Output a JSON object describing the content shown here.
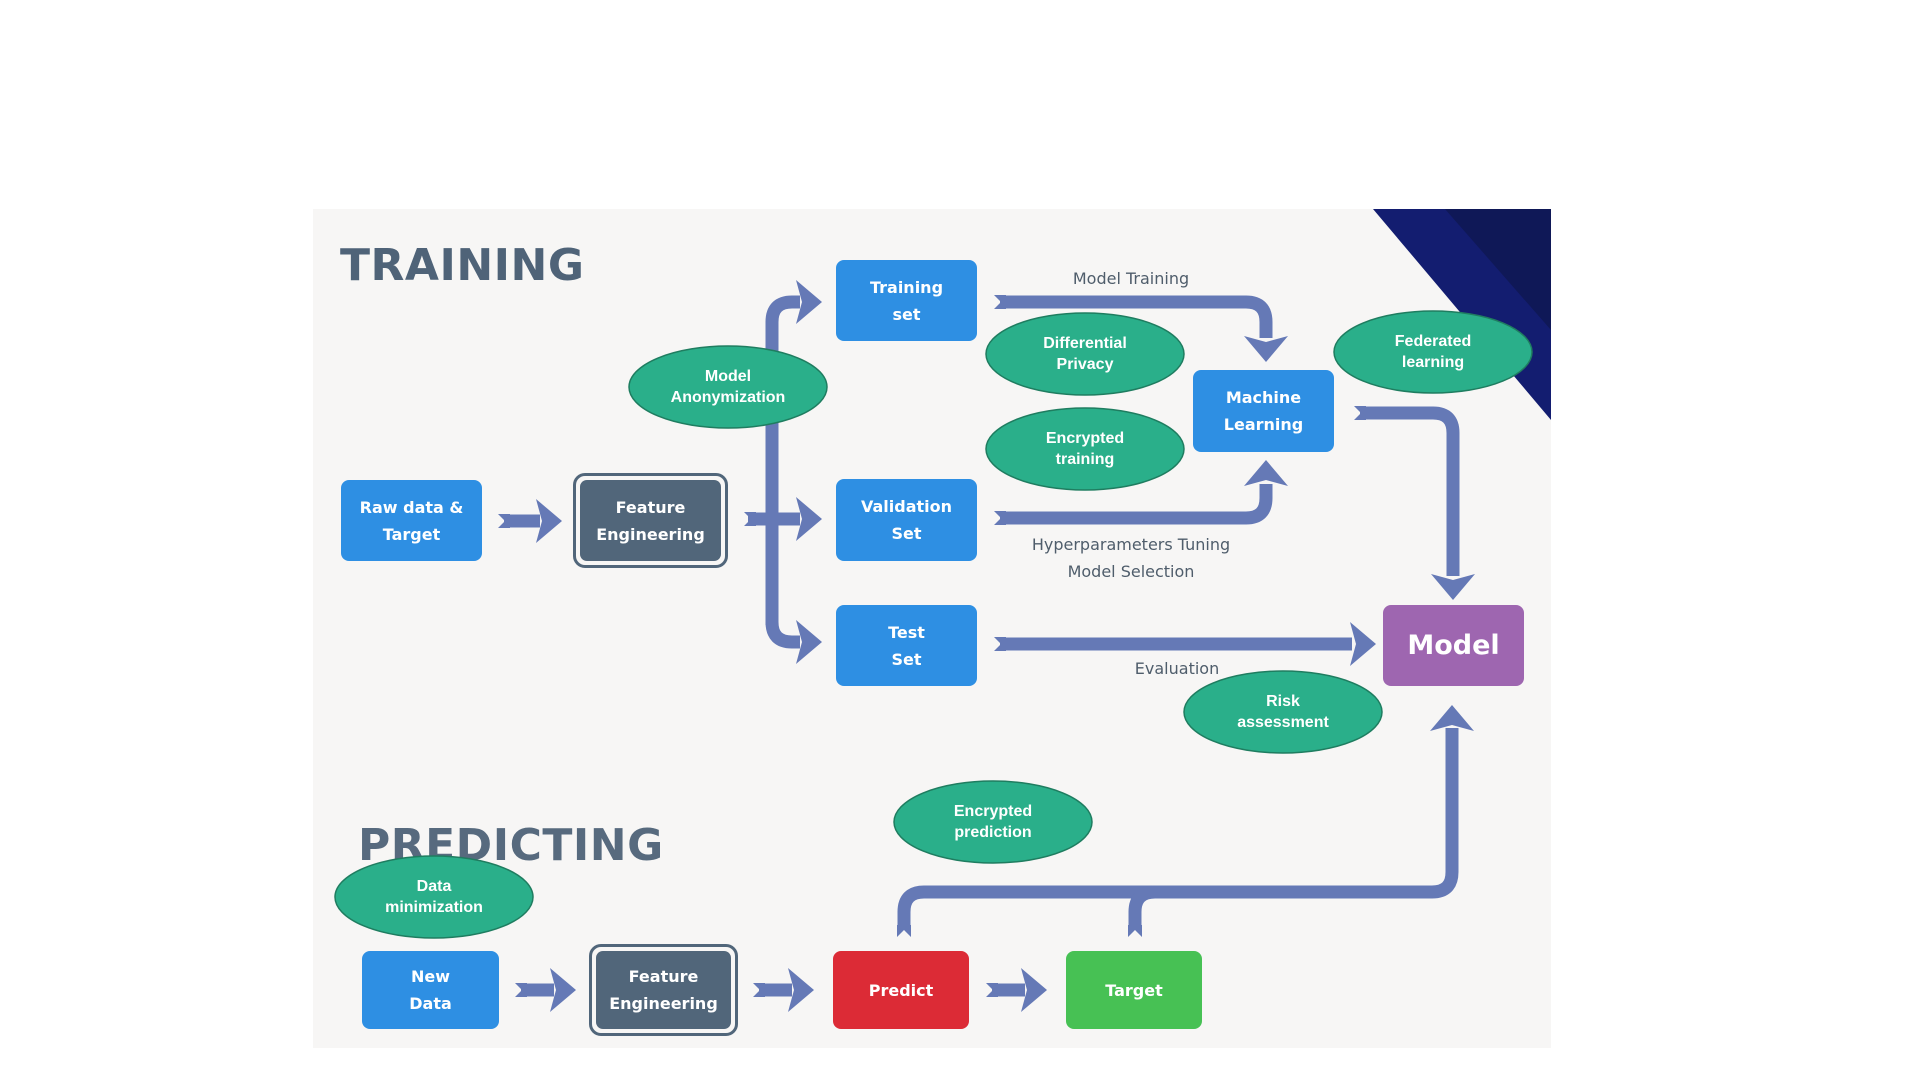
{
  "titles": {
    "training": "TRAINING",
    "predicting": "PREDICTING"
  },
  "training": {
    "raw_data": [
      "Raw data &",
      "Target"
    ],
    "feature_engineering": [
      "Feature",
      "Engineering"
    ],
    "training_set": [
      "Training",
      "set"
    ],
    "validation_set": [
      "Validation",
      "Set"
    ],
    "test_set": [
      "Test",
      "Set"
    ],
    "machine_learning": [
      "Machine",
      "Learning"
    ],
    "model": "Model"
  },
  "predicting": {
    "new_data": [
      "New",
      "Data"
    ],
    "feature_engineering": [
      "Feature",
      "Engineering"
    ],
    "predict": "Predict",
    "target": "Target"
  },
  "edge_labels": {
    "model_training": "Model Training",
    "hyperparameters_tuning": "Hyperparameters Tuning",
    "model_selection": "Model Selection",
    "evaluation": "Evaluation"
  },
  "privacy_techniques": {
    "model_anonymization": [
      "Model",
      "Anonymization"
    ],
    "differential_privacy": [
      "Differential",
      "Privacy"
    ],
    "encrypted_training": [
      "Encrypted",
      "training"
    ],
    "federated_learning": [
      "Federated",
      "learning"
    ],
    "risk_assessment": [
      "Risk",
      "assessment"
    ],
    "encrypted_prediction": [
      "Encrypted",
      "prediction"
    ],
    "data_minimization": [
      "Data",
      "minimization"
    ]
  },
  "colors": {
    "panel_bg": "#f7f6f5",
    "data_box": "#2e8fe3",
    "feature_box": "#51667a",
    "model_box": "#9e66b0",
    "predict_box": "#dc2b36",
    "target_box": "#47c154",
    "privacy_ellipse": "#2aaf8a",
    "arrow": "#6579b6",
    "accent_triangle": "#121c6a"
  }
}
